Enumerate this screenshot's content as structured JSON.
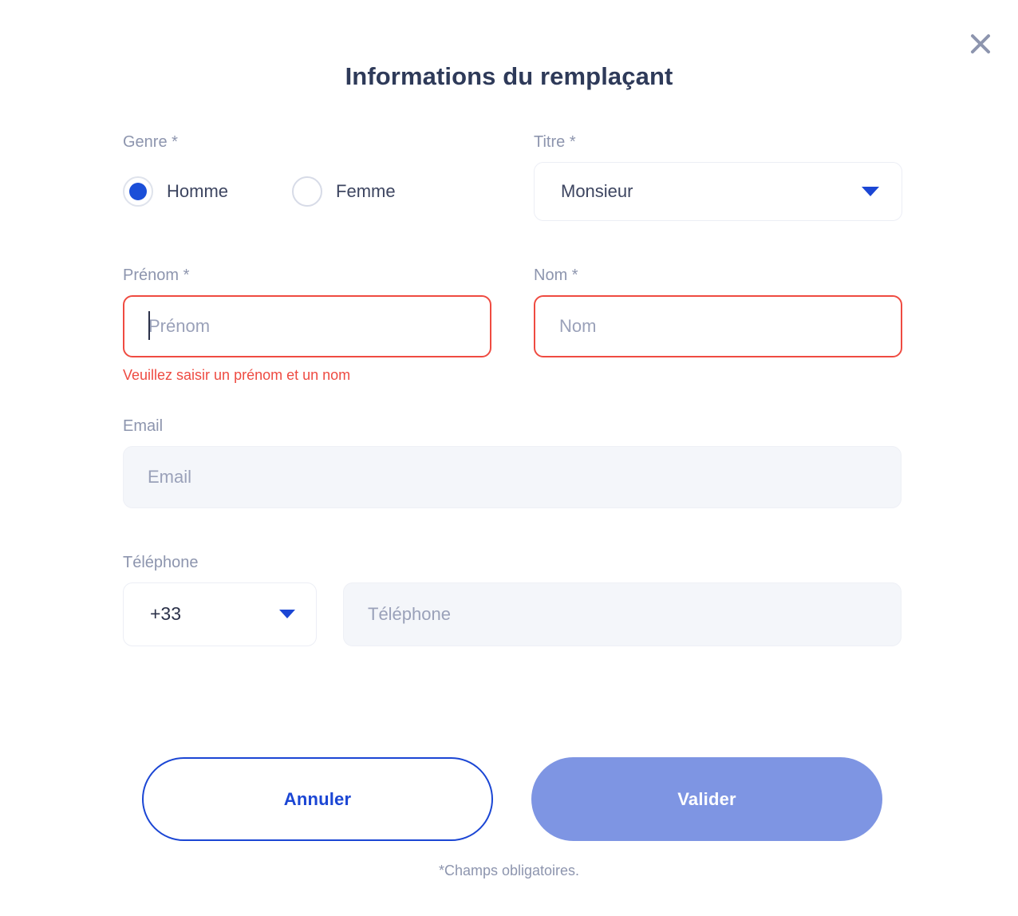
{
  "modal": {
    "title": "Informations du remplaçant",
    "close_icon": "close-icon",
    "footnote": "*Champs obligatoires."
  },
  "fields": {
    "gender": {
      "label": "Genre *",
      "options": [
        {
          "label": "Homme",
          "selected": true
        },
        {
          "label": "Femme",
          "selected": false
        }
      ]
    },
    "title": {
      "label": "Titre *",
      "value": "Monsieur",
      "chevron_icon": "chevron-down-icon"
    },
    "firstname": {
      "label": "Prénom *",
      "value": "",
      "placeholder": "Prénom",
      "error": "Veuillez saisir un prénom et un nom",
      "focused": true
    },
    "lastname": {
      "label": "Nom *",
      "value": "",
      "placeholder": "Nom"
    },
    "email": {
      "label": "Email",
      "value": "",
      "placeholder": "Email"
    },
    "phone": {
      "label": "Téléphone",
      "country_code": "+33",
      "chevron_icon": "chevron-down-icon",
      "value": "",
      "placeholder": "Téléphone"
    }
  },
  "actions": {
    "cancel_label": "Annuler",
    "submit_label": "Valider"
  },
  "colors": {
    "title": "#2E3A59",
    "label": "#8D95AE",
    "error": "#EF4B41",
    "primary_blue": "#1B46D4",
    "radio_blue": "#1B4FD8",
    "submit_fill": "#7E95E3",
    "input_fill": "#F4F6FA",
    "border_light": "#ECEEF5"
  }
}
